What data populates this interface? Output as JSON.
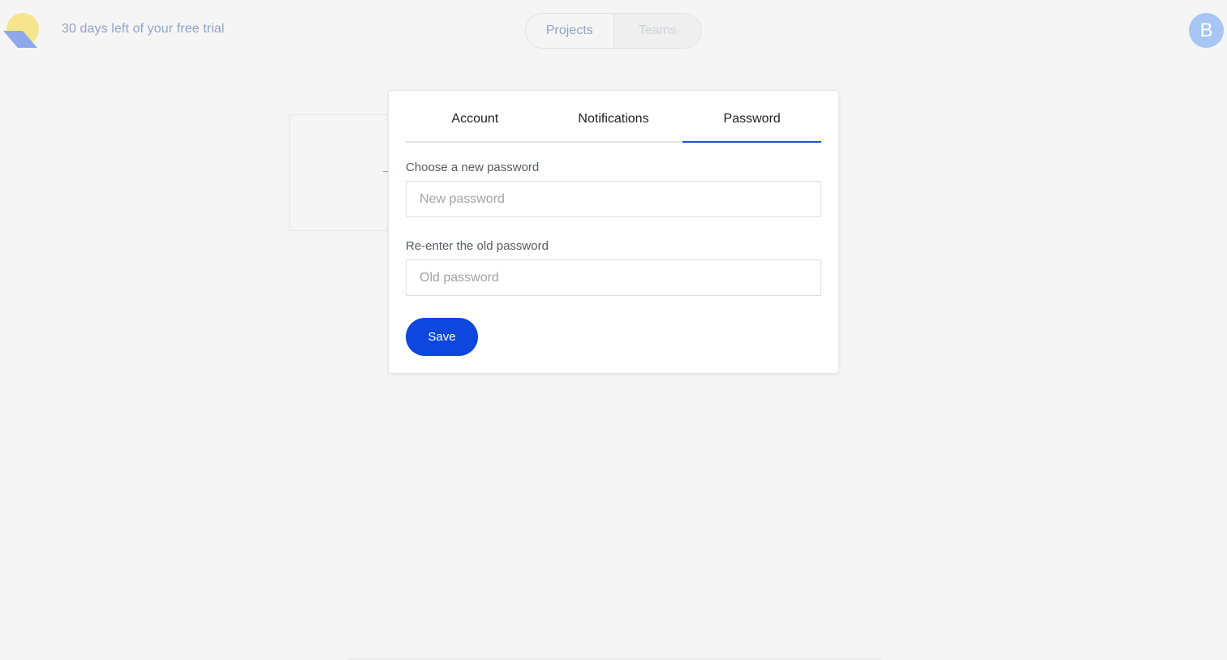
{
  "header": {
    "logo_icon": "half-sun-logo",
    "trial_text": "30 days left of your free trial",
    "nav": {
      "projects_label": "Projects",
      "teams_label": "Teams"
    },
    "avatar_initial": "B"
  },
  "settings_modal": {
    "tabs": [
      {
        "label": "Account",
        "active": false
      },
      {
        "label": "Notifications",
        "active": false
      },
      {
        "label": "Password",
        "active": true
      }
    ],
    "new_password": {
      "label": "Choose a new password",
      "placeholder": "New password",
      "value": ""
    },
    "old_password": {
      "label": "Re-enter the old password",
      "placeholder": "Old password",
      "value": ""
    },
    "save_label": "Save"
  },
  "colors": {
    "background": "#f5f5f5",
    "accent": "#0d47e0",
    "tab_indicator": "#1f4fd8",
    "avatar": "#a7c6f4",
    "logo_yellow": "#f6e58d",
    "logo_blue": "#8fa8ec"
  }
}
